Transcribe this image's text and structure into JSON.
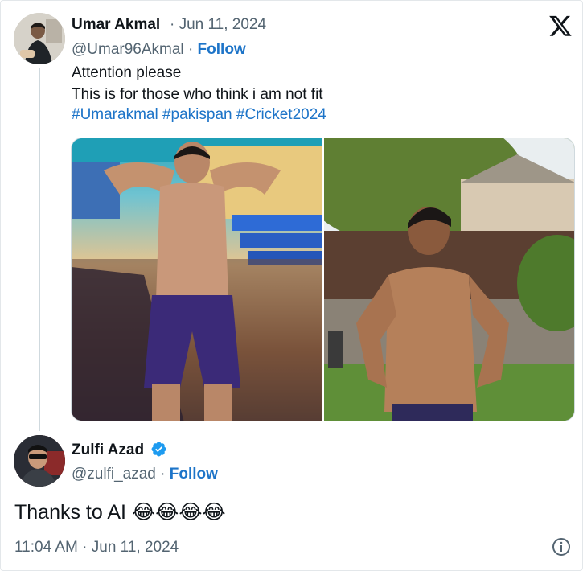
{
  "brand": {
    "logo_icon": "x-logo-icon"
  },
  "original_tweet": {
    "author_name": "Umar Akmal",
    "date": "· Jun 11, 2024",
    "handle": "@Umar96Akmal",
    "separator": "·",
    "follow_label": "Follow",
    "text_line1": "Attention please",
    "text_line2": "This is for those who think i am not fit",
    "hashtags": [
      "#Umarakmal",
      "#pakispan",
      "#Cricket2024"
    ]
  },
  "reply": {
    "author_name": "Zulfi Azad",
    "verified_icon": "verified-badge-icon",
    "handle": "@zulfi_azad",
    "separator": "·",
    "follow_label": "Follow",
    "text": "Thanks to AI 😂😂😂😂",
    "timestamp": "11:04 AM · Jun 11, 2024",
    "info_icon": "info-icon"
  },
  "colors": {
    "link": "#1d74c8",
    "verified": "#1d9bf0",
    "secondary_text": "#536471"
  }
}
